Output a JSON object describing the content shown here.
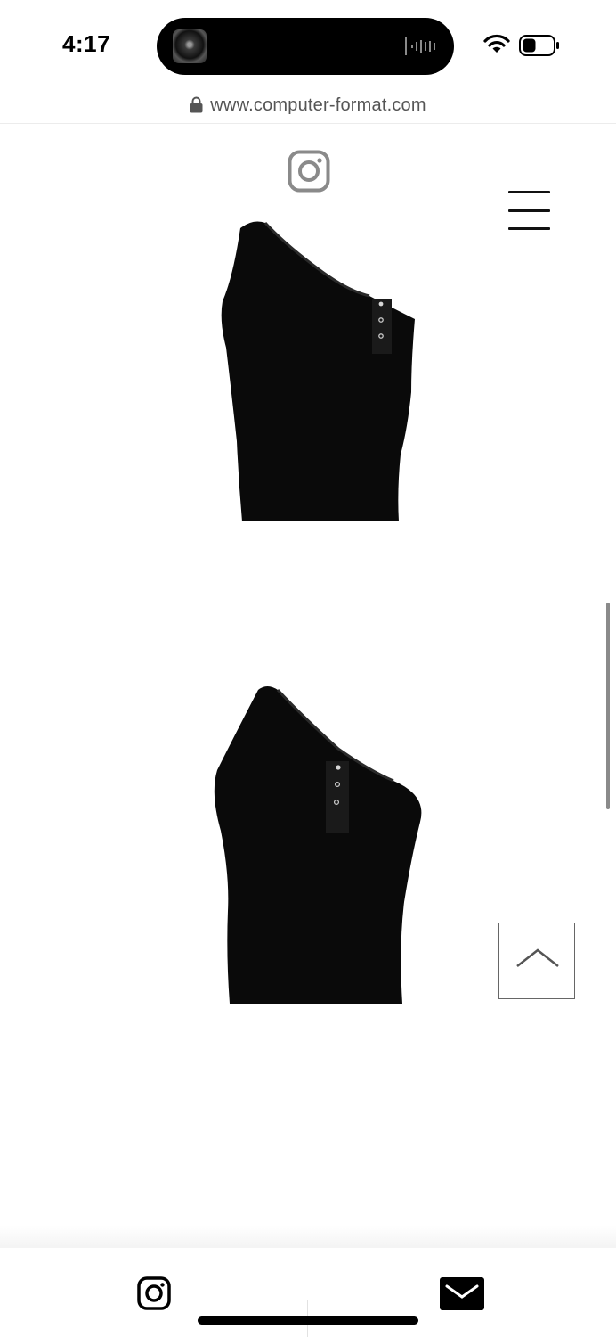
{
  "status_bar": {
    "time": "4:17",
    "icons": [
      "now-playing-artwork",
      "audio-waveform-icon",
      "wifi-icon",
      "battery-icon"
    ]
  },
  "browser": {
    "url": "www.computer-format.com",
    "secure_icon": "lock-icon"
  },
  "header": {
    "social_icon": "instagram-icon",
    "menu_icon": "hamburger-menu-icon"
  },
  "products": [
    {
      "image": "black one-shoulder tank top with snap buttons"
    },
    {
      "image": "black one-shoulder tank top with snap buttons, angled view"
    }
  ],
  "controls": {
    "back_to_top_icon": "chevron-up-icon"
  },
  "footer": {
    "icons": [
      "instagram-icon",
      "mail-icon"
    ]
  },
  "colors": {
    "background": "#ffffff",
    "ink": "#000000",
    "url_text": "#555555",
    "icon_gray": "#8a8a8a"
  }
}
